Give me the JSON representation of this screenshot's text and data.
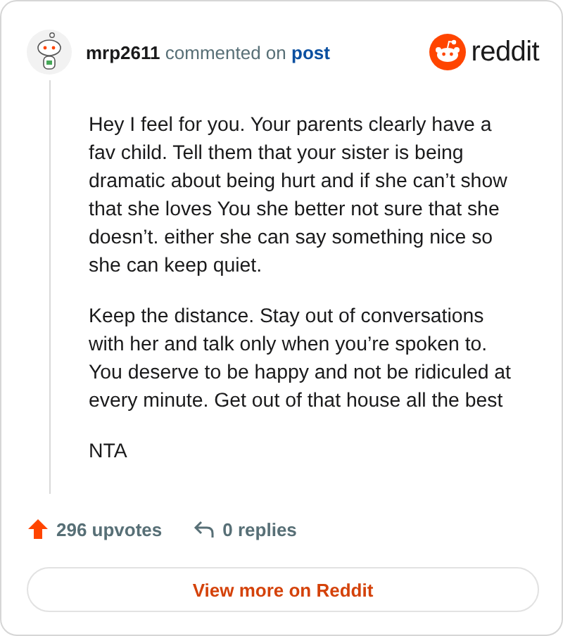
{
  "comment": {
    "author": "mrp2611",
    "action": "commented on",
    "target": "post"
  },
  "brand": {
    "name": "reddit"
  },
  "paragraphs": [
    "Hey I feel for you. Your parents clearly have a fav child. Tell them that your sister is being dramatic about being hurt and if she can’t show that she loves You she better not sure that she doesn’t. either she can say something nice so she can keep quiet.",
    "Keep the distance. Stay out of conversations with her and talk only when you’re spoken to. You deserve to be happy and not be ridiculed at every minute. Get out of that house all the best",
    "NTA"
  ],
  "stats": {
    "upvotes": "296 upvotes",
    "replies": "0 replies"
  },
  "button": {
    "label": "View more on Reddit"
  }
}
